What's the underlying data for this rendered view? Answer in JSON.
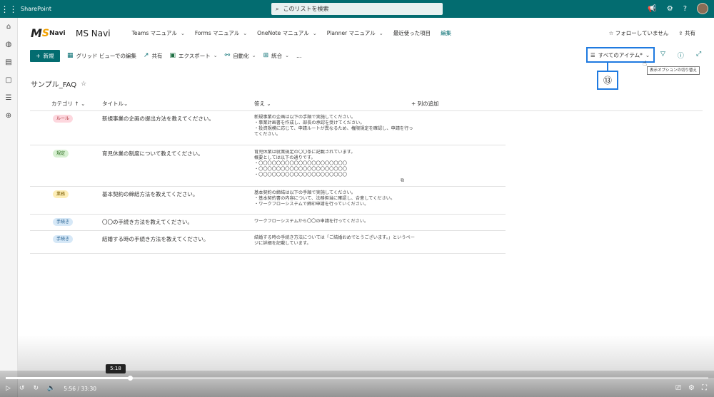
{
  "topbar": {
    "brand": "SharePoint",
    "search_placeholder": "このリストを検索"
  },
  "site": {
    "name": "MS Navi",
    "logo_text": "MSNavi",
    "nav": [
      {
        "label": "Teams マニュアル"
      },
      {
        "label": "Forms マニュアル"
      },
      {
        "label": "OneNote マニュアル"
      },
      {
        "label": "Planner マニュアル"
      }
    ],
    "recent": "最近使った項目",
    "edit": "編集",
    "follow": "フォローしていません",
    "share": "共有"
  },
  "commands": {
    "new": "新規",
    "grid": "グリッド ビューでの編集",
    "share": "共有",
    "export": "エクスポート",
    "automate": "自動化",
    "integrate": "統合",
    "more": "…",
    "view": "すべてのアイテム*",
    "tooltip": "表示オプションの切り替え",
    "callout": "⑬"
  },
  "list": {
    "title": "サンプル_FAQ",
    "columns": {
      "category": "カテゴリ ↑",
      "title": "タイトル",
      "answer": "答え",
      "add": "列の追加"
    },
    "rows": [
      {
        "category": "ルール",
        "title": "新規事業の企画の提出方法を教えてください。",
        "answer": "新規事業の企画は以下の手順で実施してください。\n・事業計画書を作成し、部長の承認を受けてください。\n・投資規模に応じて、申請ルートが異なるため、権限規定を確認し、申請を行ってください。"
      },
      {
        "category": "規定",
        "title": "育児休業の制度について教えてください。",
        "answer": "育児休業は就業規定の〇〇条に記載されています。\n概要としては以下の通りです。\n・〇〇〇〇〇〇〇〇〇〇〇〇〇〇〇〇〇〇〇〇\n・〇〇〇〇〇〇〇〇〇〇〇〇〇〇〇〇〇〇〇〇\n・〇〇〇〇〇〇〇〇〇〇〇〇〇〇〇〇〇〇〇〇"
      },
      {
        "category": "業務",
        "title": "基本契約の締結方法を教えてください。",
        "answer": "基本契約の締結は以下の手順で実施してください。\n・基本契約書の内容について、法務担当に確認し、合意してください。\n・ワークフローシステムで締印申請を行っていください。"
      },
      {
        "category": "手続き",
        "title": "〇〇の手続き方法を教えてください。",
        "answer": "ワークフローシステムから〇〇の申請を行ってください。"
      },
      {
        "category": "手続き",
        "title": "結婚する時の手続き方法を教えてください。",
        "answer": "結婚する時の手続き方法については「ご結婚おめでとうございます。」というページに詳細を記載しています。"
      }
    ]
  },
  "badge_colors": {
    "ルール": {
      "bg": "#fdd7de",
      "fg": "#a4262c"
    },
    "規定": {
      "bg": "#d7f0d2",
      "fg": "#2b6b1e"
    },
    "業務": {
      "bg": "#fdeeb7",
      "fg": "#7a5b00"
    },
    "手続き": {
      "bg": "#d6e8f7",
      "fg": "#1c5a8c"
    }
  },
  "video": {
    "time": "5:56 / 33:30",
    "hover_time": "5:18"
  }
}
